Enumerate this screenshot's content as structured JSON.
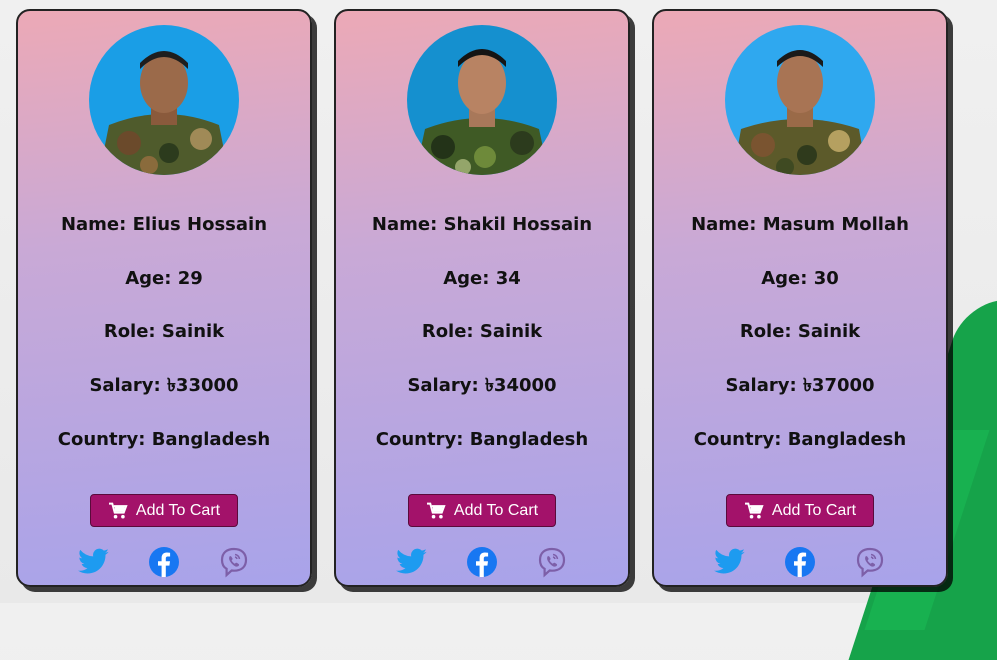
{
  "colors": {
    "card_gradient_top": "#eca9b6",
    "card_gradient_bottom": "#a8a3ea",
    "button": "#a3126a",
    "twitter": "#1d9bf0",
    "facebook": "#1877f2",
    "viber": "#7d5fa8"
  },
  "labels": {
    "name": "Name:",
    "age": "Age:",
    "role": "Role:",
    "salary": "Salary:",
    "country": "Country:"
  },
  "cards": [
    {
      "name": "Elius Hossain",
      "age": "29",
      "role": "Sainik",
      "salary": "৳33000",
      "country": "Bangladesh",
      "button_label": "Add To Cart",
      "photo_bg": "#1a9ee6",
      "social_icons": [
        "twitter-icon",
        "facebook-icon",
        "viber-icon"
      ]
    },
    {
      "name": "Shakil Hossain",
      "age": "34",
      "role": "Sainik",
      "salary": "৳34000",
      "country": "Bangladesh",
      "button_label": "Add To Cart",
      "photo_bg": "#1590cf",
      "social_icons": [
        "twitter-icon",
        "facebook-icon",
        "viber-icon"
      ]
    },
    {
      "name": "Masum Mollah",
      "age": "30",
      "role": "Sainik",
      "salary": "৳37000",
      "country": "Bangladesh",
      "button_label": "Add To Cart",
      "photo_bg": "#2fa8ef",
      "social_icons": [
        "twitter-icon",
        "facebook-icon",
        "viber-icon"
      ]
    }
  ]
}
